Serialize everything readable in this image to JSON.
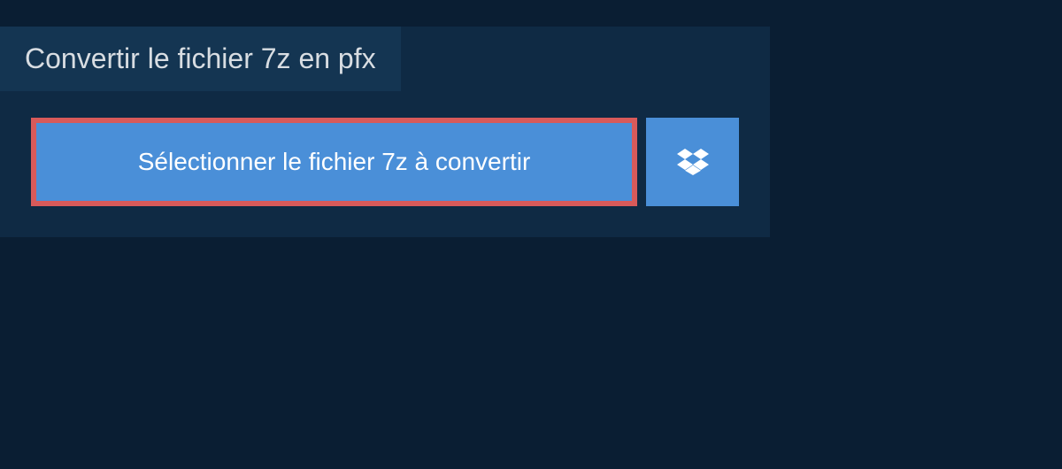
{
  "header": {
    "title": "Convertir le fichier 7z en pfx"
  },
  "actions": {
    "select_file_label": "Sélectionner le fichier 7z à convertir"
  },
  "colors": {
    "background": "#0a1e33",
    "panel": "#0f2a44",
    "tab": "#143552",
    "button": "#4a8fd8",
    "highlight_border": "#d85a5a"
  }
}
